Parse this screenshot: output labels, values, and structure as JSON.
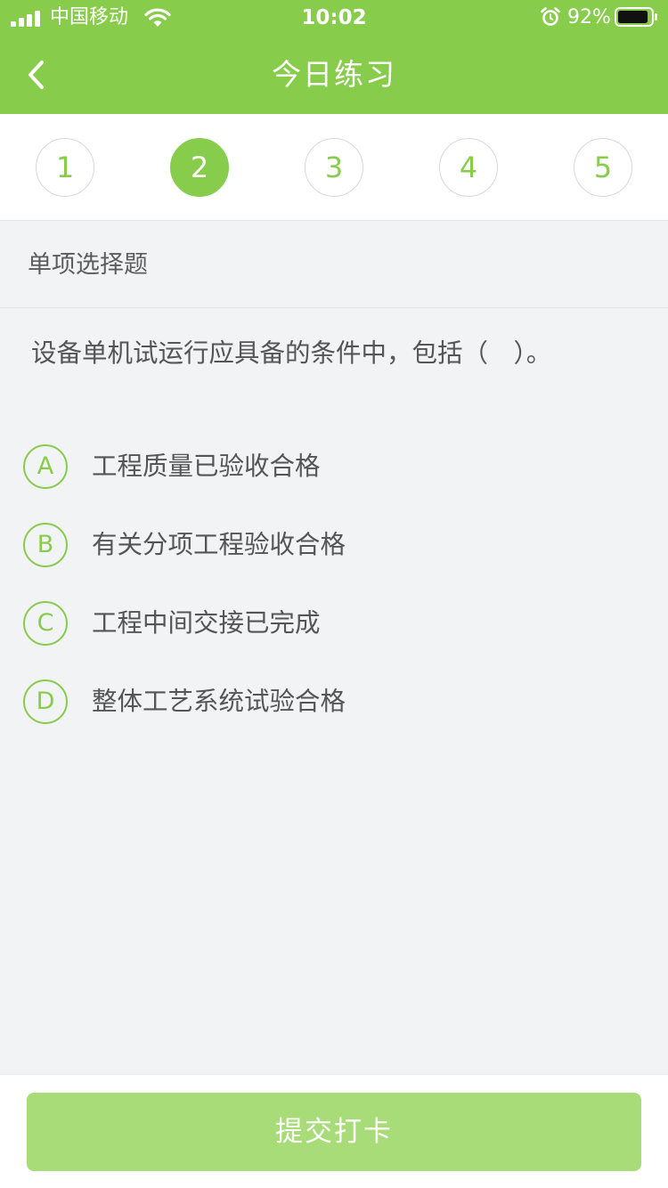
{
  "status_bar": {
    "carrier": "中国移动",
    "time": "10:02",
    "battery_percent": "92%",
    "battery_level": 0.92
  },
  "nav": {
    "title": "今日练习",
    "back_icon": "chevron-left-icon"
  },
  "question_numbers": {
    "items": [
      "1",
      "2",
      "3",
      "4",
      "5"
    ],
    "active_index": 1
  },
  "question": {
    "type": "单项选择题",
    "text": "设备单机试运行应具备的条件中，包括（　）。",
    "options": [
      {
        "letter": "A",
        "text": "工程质量已验收合格"
      },
      {
        "letter": "B",
        "text": "有关分项工程验收合格"
      },
      {
        "letter": "C",
        "text": "工程中间交接已完成"
      },
      {
        "letter": "D",
        "text": "整体工艺系统试验合格"
      }
    ]
  },
  "footer": {
    "submit_label": "提交打卡"
  },
  "colors": {
    "accent": "#88cc4c",
    "submit_button": "#a7dc78",
    "background": "#f2f3f5"
  }
}
